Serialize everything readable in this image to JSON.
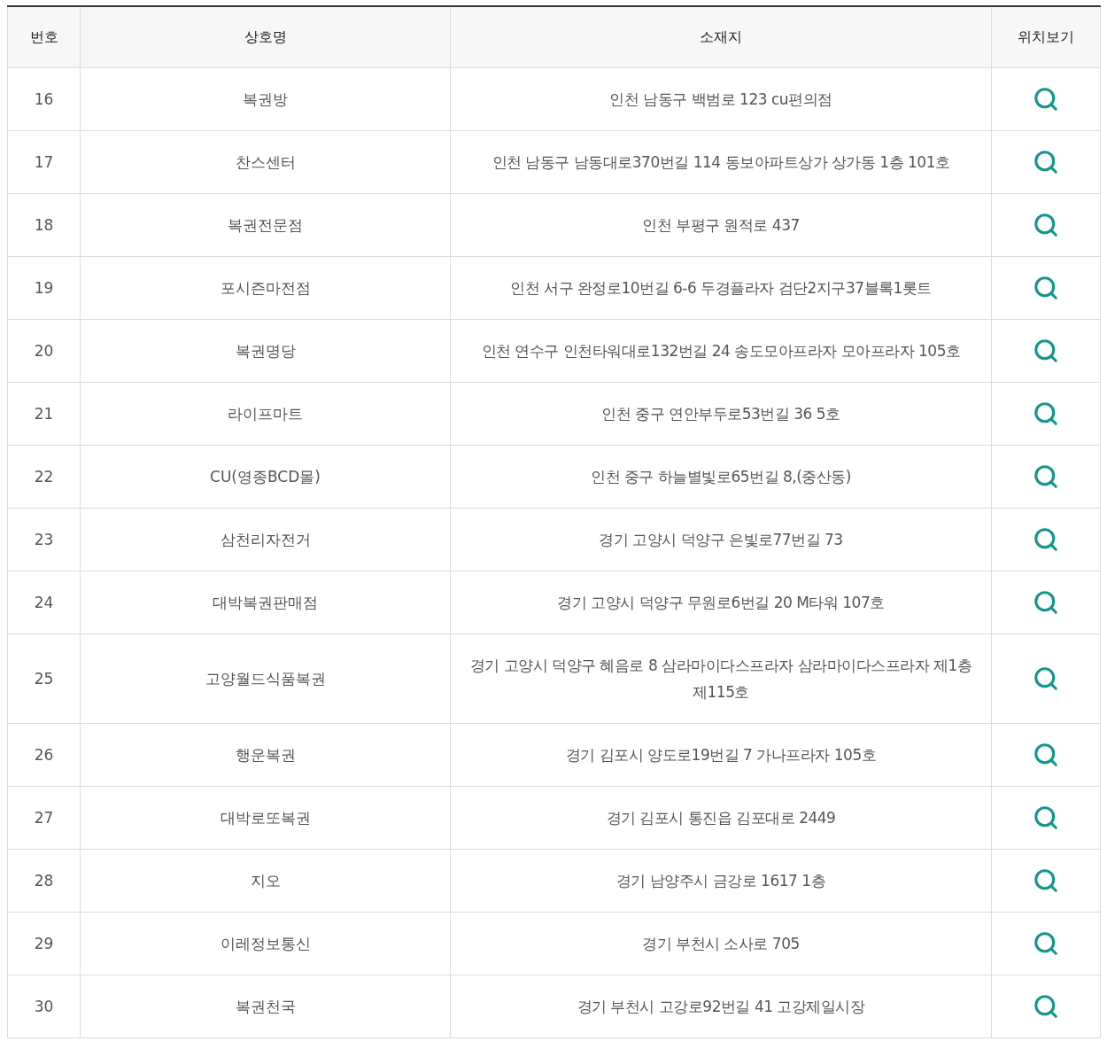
{
  "table": {
    "columns": [
      "번호",
      "상호명",
      "소재지",
      "위치보기"
    ],
    "rows": [
      {
        "number": "16",
        "name": "복권방",
        "address": "인천 남동구 백범로 123 cu편의점"
      },
      {
        "number": "17",
        "name": "찬스센터",
        "address": "인천 남동구 남동대로370번길 114 동보아파트상가 상가동 1층 101호"
      },
      {
        "number": "18",
        "name": "복권전문점",
        "address": "인천 부평구 원적로 437"
      },
      {
        "number": "19",
        "name": "포시즌마전점",
        "address": "인천 서구 완정로10번길 6-6 두경플라자 검단2지구37블록1롯트"
      },
      {
        "number": "20",
        "name": "복권명당",
        "address": "인천 연수구 인천타워대로132번길 24 송도모아프라자 모아프라자 105호"
      },
      {
        "number": "21",
        "name": "라이프마트",
        "address": "인천 중구 연안부두로53번길 36 5호"
      },
      {
        "number": "22",
        "name": "CU(영종BCD몰)",
        "address": "인천 중구 하늘별빛로65번길 8,(중산동)"
      },
      {
        "number": "23",
        "name": "삼천리자전거",
        "address": "경기 고양시 덕양구 은빛로77번길 73"
      },
      {
        "number": "24",
        "name": "대박복권판매점",
        "address": "경기 고양시 덕양구 무원로6번길 20 M타워 107호"
      },
      {
        "number": "25",
        "name": "고양월드식품복권",
        "address": "경기 고양시 덕양구 혜음로 8 삼라마이다스프라자 삼라마이다스프라자 제1층 제115호"
      },
      {
        "number": "26",
        "name": "행운복권",
        "address": "경기 김포시 양도로19번길 7 가나프라자 105호"
      },
      {
        "number": "27",
        "name": "대박로또복권",
        "address": "경기 김포시 통진읍 김포대로 2449"
      },
      {
        "number": "28",
        "name": "지오",
        "address": "경기 남양주시 금강로 1617 1층"
      },
      {
        "number": "29",
        "name": "이레정보통신",
        "address": "경기 부천시 소사로 705"
      },
      {
        "number": "30",
        "name": "복권천국",
        "address": "경기 부천시 고강로92번길 41 고강제일시장"
      }
    ]
  }
}
